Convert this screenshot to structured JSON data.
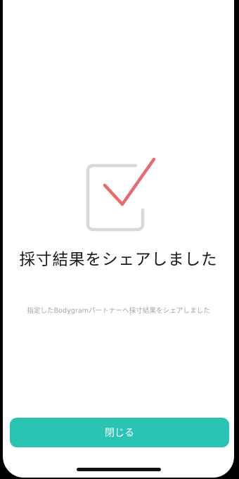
{
  "result": {
    "icon": "checkbox-checked-icon",
    "title": "採寸結果をシェアしました",
    "message": "指定したBodygramパートナーへ採寸結果をシェアしました"
  },
  "actions": {
    "close_label": "閉じる"
  },
  "colors": {
    "accent": "#2bc3b4",
    "checkmark": "#e96a6d",
    "box_outline": "#d9d9d9",
    "title_text": "#1a1a1a",
    "subtitle_text": "#a6a6a6"
  }
}
